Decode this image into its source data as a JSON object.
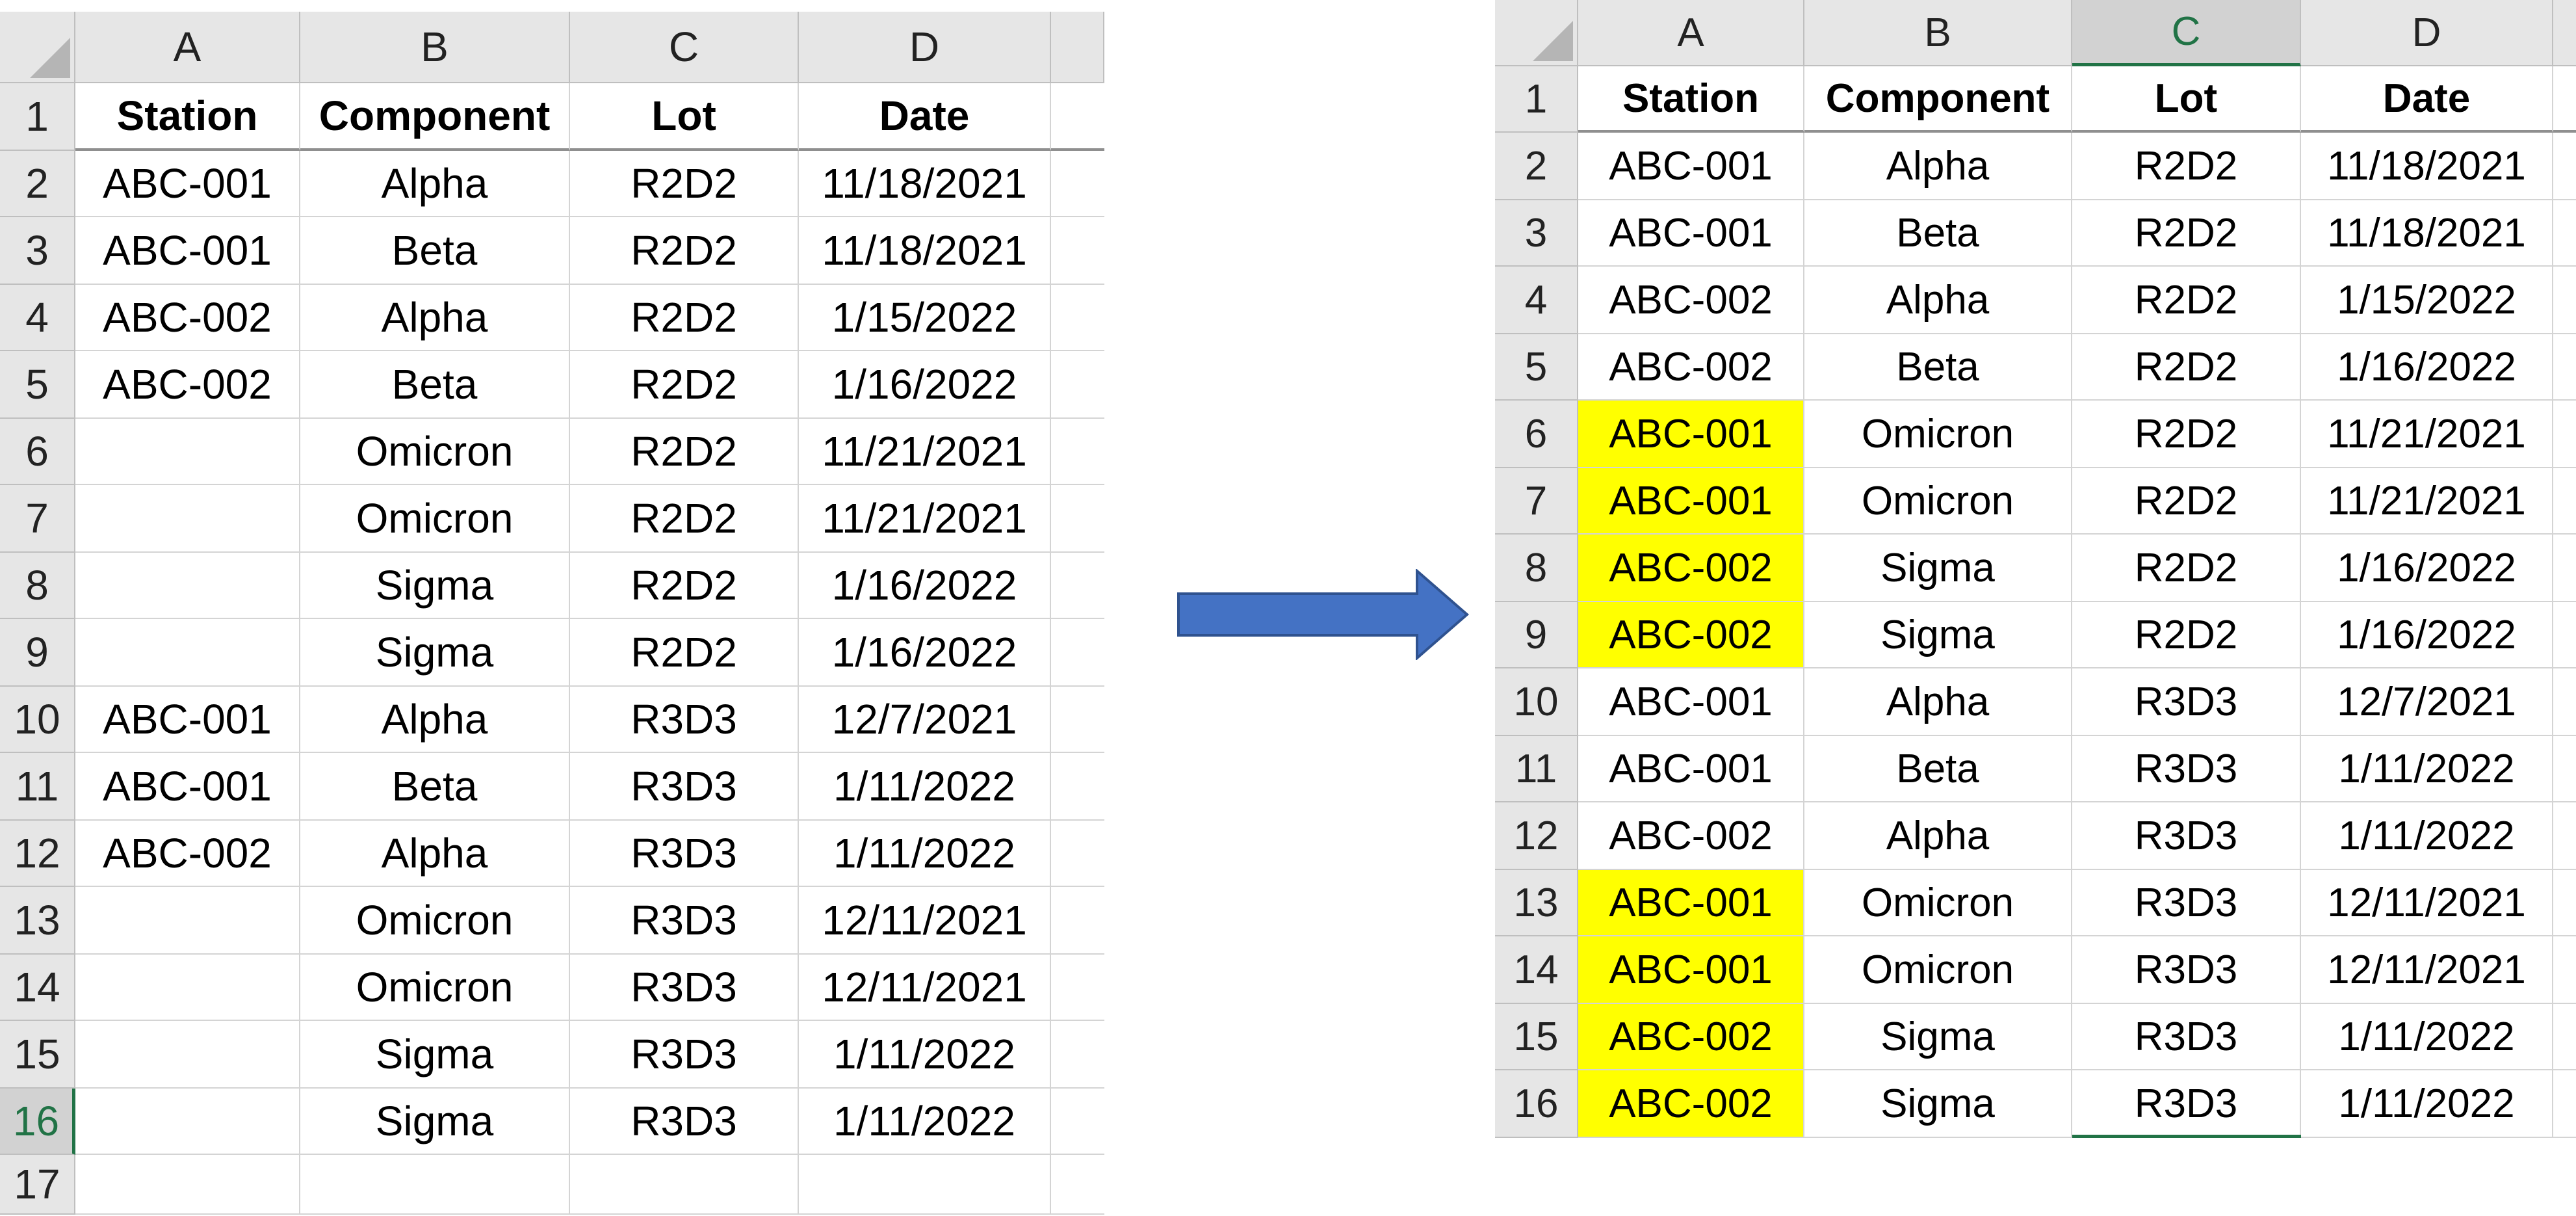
{
  "left_sheet": {
    "column_headers": [
      "A",
      "B",
      "C",
      "D"
    ],
    "row_numbers": [
      "1",
      "2",
      "3",
      "4",
      "5",
      "6",
      "7",
      "8",
      "9",
      "10",
      "11",
      "12",
      "13",
      "14",
      "15",
      "16",
      "17"
    ],
    "selected_row": "16",
    "header_row": [
      "Station",
      "Component",
      "Lot",
      "Date"
    ],
    "rows": [
      [
        "ABC-001",
        "Alpha",
        "R2D2",
        "11/18/2021"
      ],
      [
        "ABC-001",
        "Beta",
        "R2D2",
        "11/18/2021"
      ],
      [
        "ABC-002",
        "Alpha",
        "R2D2",
        "1/15/2022"
      ],
      [
        "ABC-002",
        "Beta",
        "R2D2",
        "1/16/2022"
      ],
      [
        "",
        "Omicron",
        "R2D2",
        "11/21/2021"
      ],
      [
        "",
        "Omicron",
        "R2D2",
        "11/21/2021"
      ],
      [
        "",
        "Sigma",
        "R2D2",
        "1/16/2022"
      ],
      [
        "",
        "Sigma",
        "R2D2",
        "1/16/2022"
      ],
      [
        "ABC-001",
        "Alpha",
        "R3D3",
        "12/7/2021"
      ],
      [
        "ABC-001",
        "Beta",
        "R3D3",
        "1/11/2022"
      ],
      [
        "ABC-002",
        "Alpha",
        "R3D3",
        "1/11/2022"
      ],
      [
        "",
        "Omicron",
        "R3D3",
        "12/11/2021"
      ],
      [
        "",
        "Omicron",
        "R3D3",
        "12/11/2021"
      ],
      [
        "",
        "Sigma",
        "R3D3",
        "1/11/2022"
      ],
      [
        "",
        "Sigma",
        "R3D3",
        "1/11/2022"
      ],
      [
        "",
        "",
        "",
        ""
      ]
    ]
  },
  "right_sheet": {
    "column_headers": [
      "A",
      "B",
      "C",
      "D"
    ],
    "row_numbers": [
      "1",
      "2",
      "3",
      "4",
      "5",
      "6",
      "7",
      "8",
      "9",
      "10",
      "11",
      "12",
      "13",
      "14",
      "15",
      "16"
    ],
    "selected_column": "C",
    "highlight_color": "#ffff00",
    "header_row": [
      "Station",
      "Component",
      "Lot",
      "Date"
    ],
    "rows": [
      [
        "ABC-001",
        "Alpha",
        "R2D2",
        "11/18/2021"
      ],
      [
        "ABC-001",
        "Beta",
        "R2D2",
        "11/18/2021"
      ],
      [
        "ABC-002",
        "Alpha",
        "R2D2",
        "1/15/2022"
      ],
      [
        "ABC-002",
        "Beta",
        "R2D2",
        "1/16/2022"
      ],
      [
        "ABC-001",
        "Omicron",
        "R2D2",
        "11/21/2021"
      ],
      [
        "ABC-001",
        "Omicron",
        "R2D2",
        "11/21/2021"
      ],
      [
        "ABC-002",
        "Sigma",
        "R2D2",
        "1/16/2022"
      ],
      [
        "ABC-002",
        "Sigma",
        "R2D2",
        "1/16/2022"
      ],
      [
        "ABC-001",
        "Alpha",
        "R3D3",
        "12/7/2021"
      ],
      [
        "ABC-001",
        "Beta",
        "R3D3",
        "1/11/2022"
      ],
      [
        "ABC-002",
        "Alpha",
        "R3D3",
        "1/11/2022"
      ],
      [
        "ABC-001",
        "Omicron",
        "R3D3",
        "12/11/2021"
      ],
      [
        "ABC-001",
        "Omicron",
        "R3D3",
        "12/11/2021"
      ],
      [
        "ABC-002",
        "Sigma",
        "R3D3",
        "1/11/2022"
      ],
      [
        "ABC-002",
        "Sigma",
        "R3D3",
        "1/11/2022"
      ]
    ],
    "highlighted_station_rows": [
      "6",
      "7",
      "8",
      "9",
      "13",
      "14",
      "15",
      "16"
    ]
  },
  "arrow": {
    "icon": "right-arrow-icon",
    "color": "#4472c4",
    "border_color": "#2f528f"
  }
}
